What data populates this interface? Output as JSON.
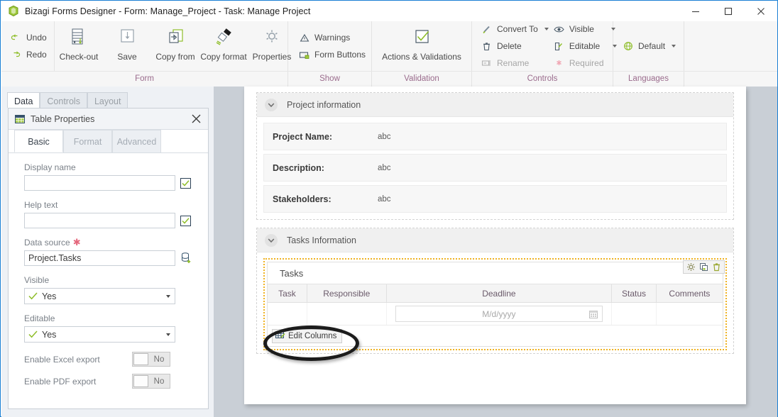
{
  "window": {
    "title": "Bizagi Forms Designer  - Form: Manage_Project - Task:  Manage Project",
    "logo": "bizagi-logo-icon",
    "controls": {
      "minimize": "minimize-icon",
      "maximize": "maximize-icon",
      "close": "close-icon"
    }
  },
  "ribbon": {
    "groups": [
      {
        "label": "Form",
        "small_items": [
          {
            "label": "Undo",
            "icon": "undo-icon",
            "disabled": false
          },
          {
            "label": "Redo",
            "icon": "redo-icon",
            "disabled": false
          }
        ],
        "big_items": [
          {
            "label": "Check-out",
            "icon": "check-out-icon"
          },
          {
            "label": "Save",
            "icon": "save-icon"
          },
          {
            "label": "Copy from",
            "icon": "copy-from-icon"
          },
          {
            "label": "Copy format",
            "icon": "copy-format-icon"
          },
          {
            "label": "Properties",
            "icon": "properties-gear-icon"
          }
        ]
      },
      {
        "label": "Show",
        "small_items": [
          {
            "label": "Warnings",
            "icon": "warning-triangle-icon",
            "disabled": false
          },
          {
            "label": "Form Buttons",
            "icon": "form-buttons-icon",
            "disabled": false
          }
        ],
        "big_items": []
      },
      {
        "label": "Validation",
        "small_items": [],
        "big_items": [
          {
            "label": "Actions & Validations",
            "icon": "checkmark-box-icon"
          }
        ]
      },
      {
        "label": "Controls",
        "small_items": [
          {
            "label": "Convert To",
            "icon": "convert-to-icon",
            "has_caret": true,
            "disabled": false
          },
          {
            "label": "Delete",
            "icon": "delete-trash-icon",
            "disabled": false
          },
          {
            "label": "Rename",
            "icon": "rename-icon",
            "disabled": true
          }
        ],
        "small_items_2": [
          {
            "label": "Visible",
            "icon": "eye-icon",
            "has_caret": true,
            "disabled": false
          },
          {
            "label": "Editable",
            "icon": "editable-pencil-icon",
            "has_caret": true,
            "disabled": false
          },
          {
            "label": "Required",
            "icon": "required-asterisk-icon",
            "disabled": true
          }
        ],
        "big_items": []
      },
      {
        "label": "Languages",
        "small_items": [
          {
            "label": "Default",
            "icon": "globe-icon",
            "has_caret": true,
            "disabled": false
          }
        ],
        "big_items": []
      }
    ]
  },
  "left_panel": {
    "tabs": [
      {
        "label": "Data",
        "active": true
      },
      {
        "label": "Controls",
        "active": false
      },
      {
        "label": "Layout",
        "active": false
      }
    ],
    "properties": {
      "icon": "table-icon",
      "title": "Table Properties",
      "close": "close-icon",
      "inner_tabs": [
        {
          "label": "Basic",
          "active": true
        },
        {
          "label": "Format",
          "active": false
        },
        {
          "label": "Advanced",
          "active": false
        }
      ],
      "fields": {
        "display_name": {
          "label": "Display name",
          "value": "",
          "placeholder": "",
          "checkbox": true
        },
        "help_text": {
          "label": "Help text",
          "value": "",
          "placeholder": "",
          "checkbox": true
        },
        "data_source": {
          "label": "Data source",
          "required": true,
          "value": "Project.Tasks",
          "icon": "database-add-icon"
        },
        "visible": {
          "label": "Visible",
          "value": "Yes"
        },
        "editable": {
          "label": "Editable",
          "value": "Yes"
        },
        "excel_export": {
          "label": "Enable Excel export",
          "value": "No"
        },
        "pdf_export": {
          "label": "Enable PDF export",
          "value": "No"
        }
      }
    }
  },
  "canvas": {
    "sections": [
      {
        "title": "Project information",
        "toggle": "chevron-down-icon",
        "rows": [
          {
            "label": "Project Name:",
            "value": "abc"
          },
          {
            "label": "Description:",
            "value": "abc"
          },
          {
            "label": "Stakeholders:",
            "value": "abc"
          }
        ]
      },
      {
        "title": "Tasks Information",
        "toggle": "chevron-down-icon",
        "table": {
          "caption": "Tasks",
          "toolbar": [
            {
              "icon": "gear-icon",
              "name": "table-settings"
            },
            {
              "icon": "duplicate-icon",
              "name": "table-duplicate"
            },
            {
              "icon": "trash-icon",
              "name": "table-delete"
            }
          ],
          "columns": [
            "Task",
            "Responsible",
            "Deadline",
            "Status",
            "Comments"
          ],
          "rows": [
            {
              "task": "",
              "responsible": "",
              "deadline_placeholder": "M/d/yyyy",
              "deadline_icon": "calendar-icon",
              "status": "",
              "comments": ""
            }
          ],
          "footer_button": {
            "label": "Edit Columns",
            "icon": "edit-columns-icon"
          }
        }
      }
    ]
  },
  "annotation": {
    "highlight_target": "edit-columns-button",
    "shape": "ellipse",
    "color": "#1c1c1c"
  },
  "colors": {
    "accent_blue": "#1a7fd4",
    "green": "#7ab317",
    "selection_orange": "#f0b323",
    "group_label": "#9a6b8c"
  }
}
